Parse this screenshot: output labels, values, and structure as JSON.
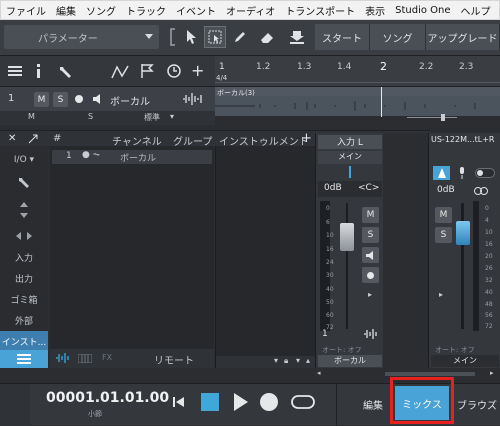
{
  "menubar": {
    "items": [
      "ファイル",
      "編集",
      "ソング",
      "トラック",
      "イベント",
      "オーディオ",
      "トランスポート",
      "表示",
      "Studio One",
      "ヘルプ"
    ]
  },
  "toolbar": {
    "preset_label": "パラメーター",
    "start_label": "スタート",
    "song_label": "ソング",
    "upgrade_label": "アップグレード"
  },
  "ruler": {
    "marks": [
      "1",
      "1.2",
      "1.3",
      "1.4",
      "2",
      "2.2",
      "2.3"
    ],
    "time_sig": "4/4"
  },
  "track": {
    "number": "1",
    "mute": "M",
    "solo": "S",
    "name": "ボーカル",
    "sub_m": "M",
    "sub_s": "S",
    "mode": "標準",
    "clip_name": "ボーカル(3)"
  },
  "console": {
    "col_num": "#",
    "col_channel": "チャンネル",
    "col_group": "グループ",
    "inst_header": "インストゥルメント",
    "add": "+",
    "row_number": "1",
    "row_name": "ボーカル",
    "remote_label": "リモート",
    "fx_label": "FX"
  },
  "sidebar": {
    "io_label": "I/O",
    "items": [
      "入力",
      "出力",
      "ゴミ箱",
      "外部",
      "インスト..."
    ]
  },
  "strip1": {
    "input": "入力 L",
    "bus": "メイン",
    "volume": "0dB",
    "pan": "<C>",
    "mute": "M",
    "solo": "S",
    "number": "1",
    "auto": "オート: オフ",
    "name": "ボーカル",
    "scale": [
      "0",
      "6",
      "10",
      "16",
      "24",
      "30",
      "40",
      "50",
      "60",
      "72"
    ]
  },
  "strip2": {
    "device": "US-122M...tL+R",
    "volume": "0dB",
    "mute": "M",
    "solo": "S",
    "auto": "オート: オフ",
    "name": "メイン",
    "scale": [
      "0",
      "4",
      "10",
      "16",
      "20",
      "26",
      "32",
      "40",
      "48",
      "56",
      "72"
    ]
  },
  "transport": {
    "time": "00001.01.01.00",
    "time_unit": "小節",
    "edit_label": "編集",
    "mix_label": "ミックス",
    "browse_label": "ブラウズ"
  },
  "colors": {
    "accent": "#41a6d8",
    "highlight": "#e8201e",
    "selected_tab": "#4aa3d6"
  }
}
